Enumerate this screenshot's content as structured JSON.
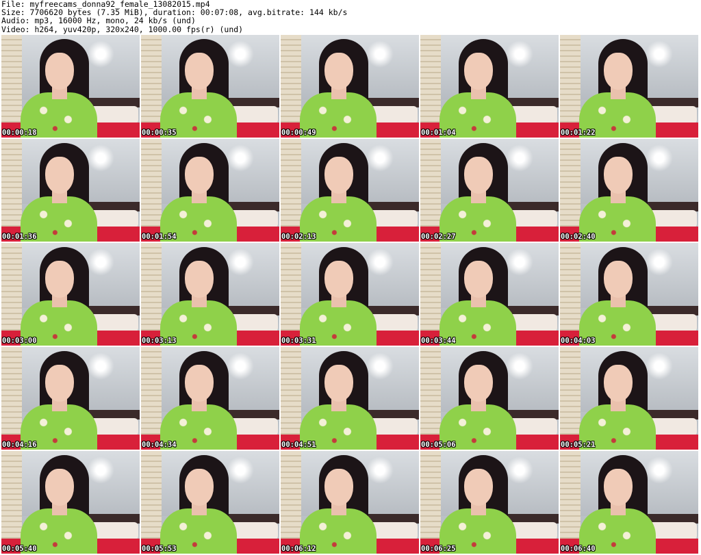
{
  "header": {
    "file_line": "File: myfreecams_donna92_female_13082015.mp4",
    "size_line": "Size: 7706620 bytes (7.35 MiB), duration: 00:07:08, avg.bitrate: 144 kb/s",
    "audio_line": "Audio: mp3, 16000 Hz, mono, 24 kb/s (und)",
    "video_line": "Video: h264, yuv420p, 320x240, 1000.00 fps(r) (und)"
  },
  "thumbnails": [
    {
      "timestamp": "00:00:18"
    },
    {
      "timestamp": "00:00:35"
    },
    {
      "timestamp": "00:00:49"
    },
    {
      "timestamp": "00:01:04"
    },
    {
      "timestamp": "00:01:22"
    },
    {
      "timestamp": "00:01:36"
    },
    {
      "timestamp": "00:01:54"
    },
    {
      "timestamp": "00:02:13"
    },
    {
      "timestamp": "00:02:27"
    },
    {
      "timestamp": "00:02:40"
    },
    {
      "timestamp": "00:03:00"
    },
    {
      "timestamp": "00:03:13"
    },
    {
      "timestamp": "00:03:31"
    },
    {
      "timestamp": "00:03:44"
    },
    {
      "timestamp": "00:04:03"
    },
    {
      "timestamp": "00:04:16"
    },
    {
      "timestamp": "00:04:34"
    },
    {
      "timestamp": "00:04:51"
    },
    {
      "timestamp": "00:05:06"
    },
    {
      "timestamp": "00:05:21"
    },
    {
      "timestamp": "00:05:40"
    },
    {
      "timestamp": "00:05:53"
    },
    {
      "timestamp": "00:06:12"
    },
    {
      "timestamp": "00:06:25"
    },
    {
      "timestamp": "00:06:40"
    }
  ],
  "colors": {
    "background": "#ffffff",
    "dress": "#8fd14a",
    "hair": "#1c1417",
    "bed_sheet": "#d8203a"
  }
}
